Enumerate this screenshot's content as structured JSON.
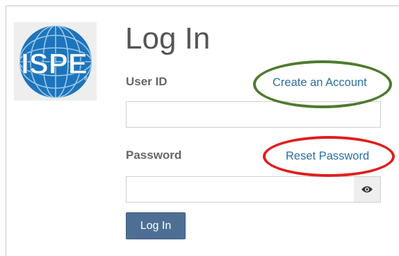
{
  "logo": {
    "text": "ISPE",
    "registered_mark": "®",
    "colors": {
      "globe": "#1c75bc",
      "globe_lines": "#9fc8e8",
      "text": "#ffffff"
    }
  },
  "page": {
    "title": "Log In"
  },
  "form": {
    "user_id_label": "User ID",
    "user_id_value": "",
    "create_account_link": "Create an Account",
    "password_label": "Password",
    "password_value": "",
    "reset_password_link": "Reset Password",
    "show_password_icon": "eye-icon",
    "submit_label": "Log In"
  },
  "annotations": {
    "create_account_highlight_color": "#4e7a2e",
    "reset_password_highlight_color": "#e01d1d"
  },
  "colors": {
    "accent_button": "#4d6f94",
    "link": "#2a6ea6",
    "label": "#666666",
    "title": "#555555"
  }
}
